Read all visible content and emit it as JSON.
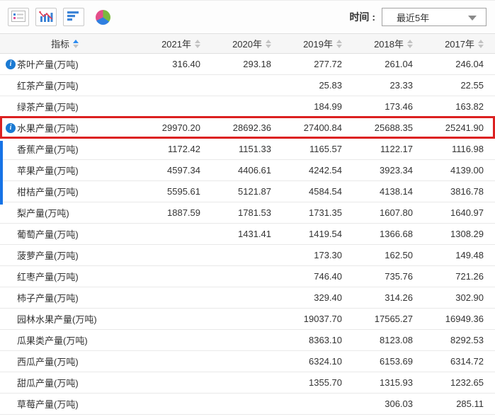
{
  "toolbar": {
    "icons": [
      {
        "name": "list-view-icon"
      },
      {
        "name": "line-bar-chart-icon"
      },
      {
        "name": "horizontal-bar-chart-icon"
      },
      {
        "name": "pie-chart-icon"
      }
    ],
    "time_label": "时间 :",
    "time_dropdown": {
      "value": "最近5年"
    }
  },
  "table": {
    "indicator_header": "指标",
    "year_headers": [
      "2021年",
      "2020年",
      "2019年",
      "2018年",
      "2017年"
    ],
    "rows": [
      {
        "label": "茶叶产量(万吨)",
        "info": true,
        "highlighted": false,
        "values": [
          "316.40",
          "293.18",
          "277.72",
          "261.04",
          "246.04"
        ]
      },
      {
        "label": "红茶产量(万吨)",
        "info": false,
        "highlighted": false,
        "values": [
          "",
          "",
          "25.83",
          "23.33",
          "22.55"
        ]
      },
      {
        "label": "绿茶产量(万吨)",
        "info": false,
        "highlighted": false,
        "values": [
          "",
          "",
          "184.99",
          "173.46",
          "163.82"
        ]
      },
      {
        "label": "水果产量(万吨)",
        "info": true,
        "highlighted": true,
        "values": [
          "29970.20",
          "28692.36",
          "27400.84",
          "25688.35",
          "25241.90"
        ]
      },
      {
        "label": "香蕉产量(万吨)",
        "info": false,
        "highlighted": false,
        "values": [
          "1172.42",
          "1151.33",
          "1165.57",
          "1122.17",
          "1116.98"
        ]
      },
      {
        "label": "苹果产量(万吨)",
        "info": false,
        "highlighted": false,
        "values": [
          "4597.34",
          "4406.61",
          "4242.54",
          "3923.34",
          "4139.00"
        ]
      },
      {
        "label": "柑桔产量(万吨)",
        "info": false,
        "highlighted": false,
        "values": [
          "5595.61",
          "5121.87",
          "4584.54",
          "4138.14",
          "3816.78"
        ]
      },
      {
        "label": "梨产量(万吨)",
        "info": false,
        "highlighted": false,
        "values": [
          "1887.59",
          "1781.53",
          "1731.35",
          "1607.80",
          "1640.97"
        ]
      },
      {
        "label": "葡萄产量(万吨)",
        "info": false,
        "highlighted": false,
        "values": [
          "",
          "1431.41",
          "1419.54",
          "1366.68",
          "1308.29"
        ]
      },
      {
        "label": "菠萝产量(万吨)",
        "info": false,
        "highlighted": false,
        "values": [
          "",
          "",
          "173.30",
          "162.50",
          "149.48"
        ]
      },
      {
        "label": "红枣产量(万吨)",
        "info": false,
        "highlighted": false,
        "values": [
          "",
          "",
          "746.40",
          "735.76",
          "721.26"
        ]
      },
      {
        "label": "柿子产量(万吨)",
        "info": false,
        "highlighted": false,
        "values": [
          "",
          "",
          "329.40",
          "314.26",
          "302.90"
        ]
      },
      {
        "label": "园林水果产量(万吨)",
        "info": false,
        "highlighted": false,
        "values": [
          "",
          "",
          "19037.70",
          "17565.27",
          "16949.36"
        ]
      },
      {
        "label": "瓜果类产量(万吨)",
        "info": false,
        "highlighted": false,
        "values": [
          "",
          "",
          "8363.10",
          "8123.08",
          "8292.53"
        ]
      },
      {
        "label": "西瓜产量(万吨)",
        "info": false,
        "highlighted": false,
        "values": [
          "",
          "",
          "6324.10",
          "6153.69",
          "6314.72"
        ]
      },
      {
        "label": "甜瓜产量(万吨)",
        "info": false,
        "highlighted": false,
        "values": [
          "",
          "",
          "1355.70",
          "1315.93",
          "1232.65"
        ]
      },
      {
        "label": "草莓产量(万吨)",
        "info": false,
        "highlighted": false,
        "values": [
          "",
          "",
          "",
          "306.03",
          "285.11"
        ]
      }
    ]
  },
  "colors": {
    "highlight_border": "#dc2121",
    "info_icon": "#1b7ad3",
    "active_sort_arrow": "#2d8cf0",
    "inactive_sort_arrow": "#c3c3c3",
    "scroll_indicator": "#1673e6",
    "header_bg": "#f6f6f6"
  }
}
